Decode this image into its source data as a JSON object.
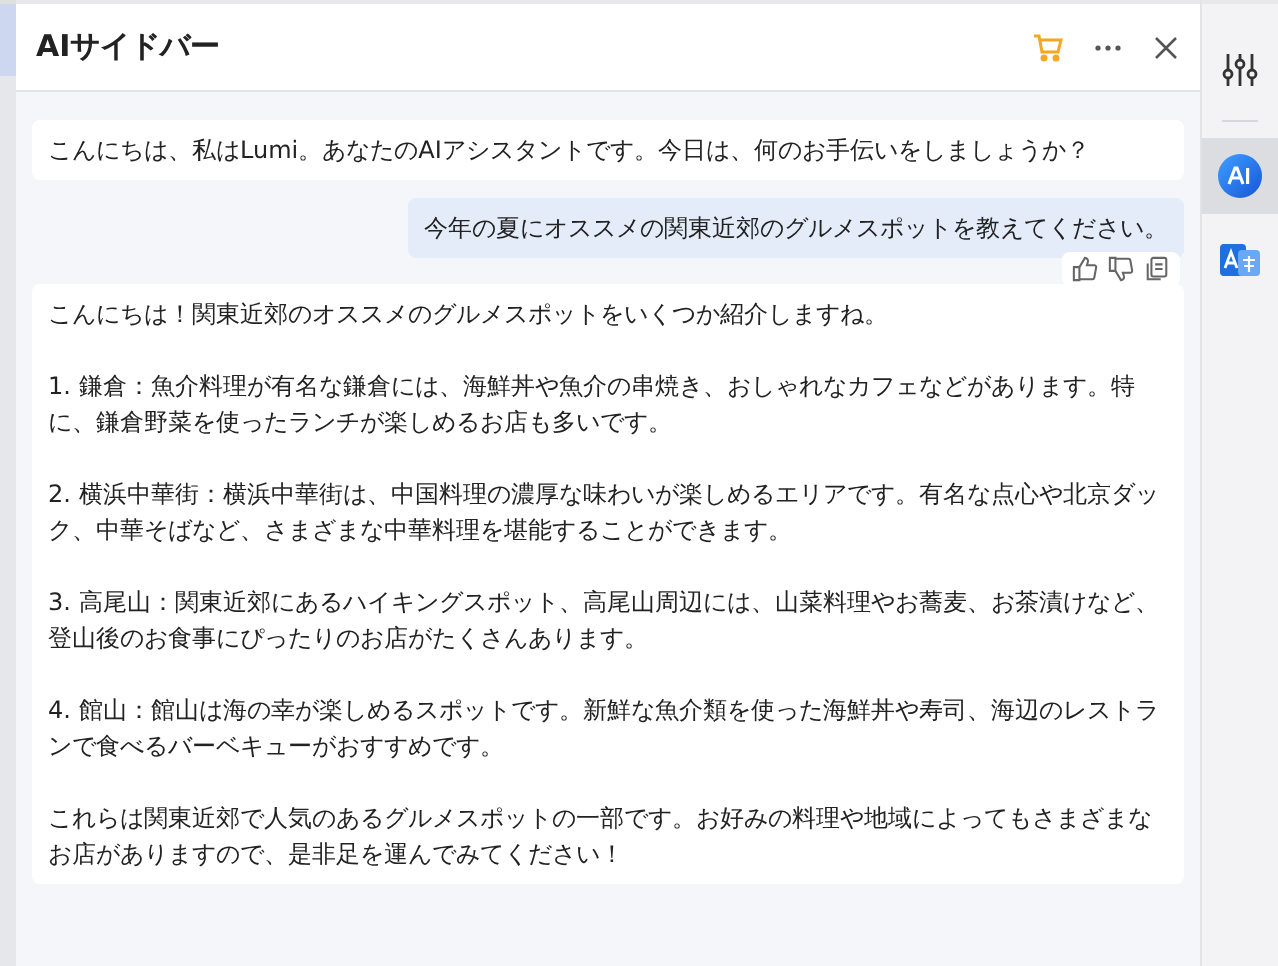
{
  "header": {
    "title": "AIサイドバー"
  },
  "messages": [
    {
      "kind": "assistant",
      "paragraphs": [
        "こんにちは、私はLumi。あなたのAIアシスタントです。今日は、何のお手伝いをしましょうか？"
      ]
    },
    {
      "kind": "user",
      "paragraphs": [
        "今年の夏にオススメの関東近郊のグルメスポットを教えてください。"
      ]
    },
    {
      "kind": "assistant",
      "paragraphs": [
        "こんにちは！関東近郊のオススメのグルメスポットをいくつか紹介しますね。",
        "1. 鎌倉：魚介料理が有名な鎌倉には、海鮮丼や魚介の串焼き、おしゃれなカフェなどがあります。特に、鎌倉野菜を使ったランチが楽しめるお店も多いです。",
        "2. 横浜中華街：横浜中華街は、中国料理の濃厚な味わいが楽しめるエリアです。有名な点心や北京ダック、中華そばなど、さまざまな中華料理を堪能することができます。",
        "3. 高尾山：関東近郊にあるハイキングスポット、高尾山周辺には、山菜料理やお蕎麦、お茶漬けなど、登山後のお食事にぴったりのお店がたくさんあります。",
        "4. 館山：館山は海の幸が楽しめるスポットです。新鮮な魚介類を使った海鮮丼や寿司、海辺のレストランで食べるバーベキューがおすすめです。",
        "これらは関東近郊で人気のあるグルメスポットの一部です。お好みの料理や地域によってもさまざまなお店がありますので、是非足を運んでみてください！"
      ]
    }
  ],
  "rail": [
    {
      "kind": "settings",
      "selected": false
    },
    {
      "kind": "ai",
      "selected": true
    },
    {
      "kind": "translate",
      "selected": false
    }
  ]
}
